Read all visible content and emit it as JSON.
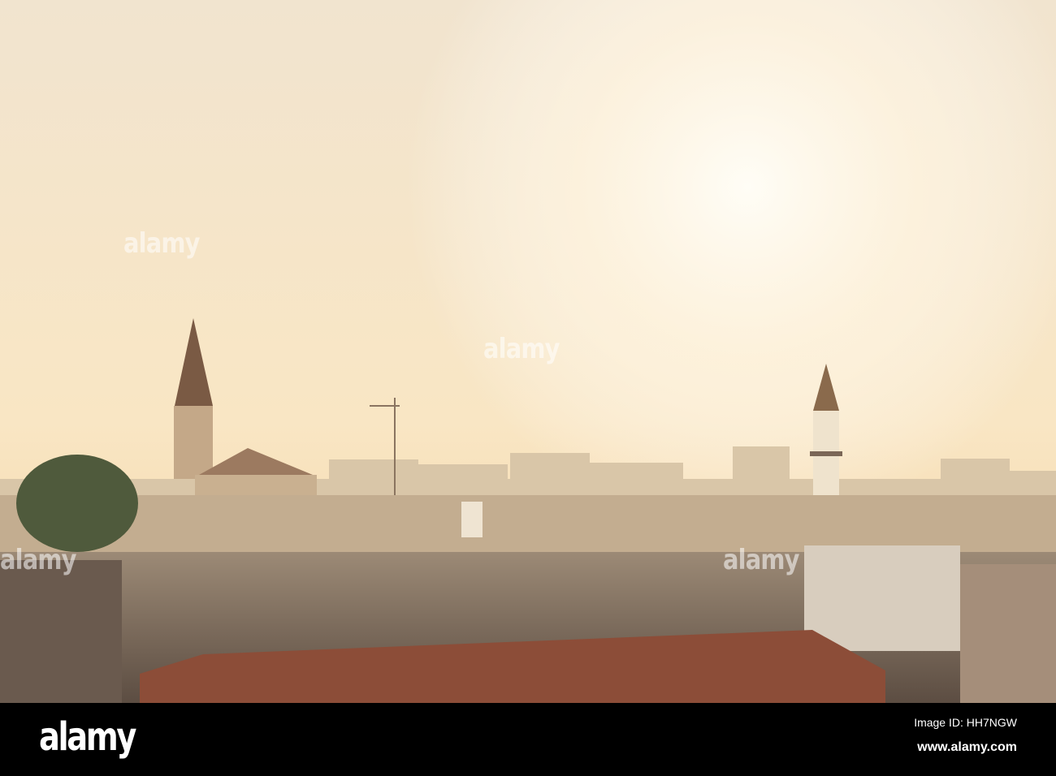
{
  "photo": {
    "subject": "Old city skyline at sunset with church spire and minaret",
    "colors": {
      "sky_top": "#f3e6cf",
      "sky_sun": "#fffaf0",
      "sky_horizon": "#f6d8a8",
      "buildings": "#b8a58c",
      "buildings_near": "#6e5e4e",
      "roof": "#8a4a36"
    }
  },
  "watermark": {
    "text": "alamy"
  },
  "footer": {
    "logo": "alamy",
    "image_id": "Image ID: HH7NGW",
    "website": "www.alamy.com"
  }
}
